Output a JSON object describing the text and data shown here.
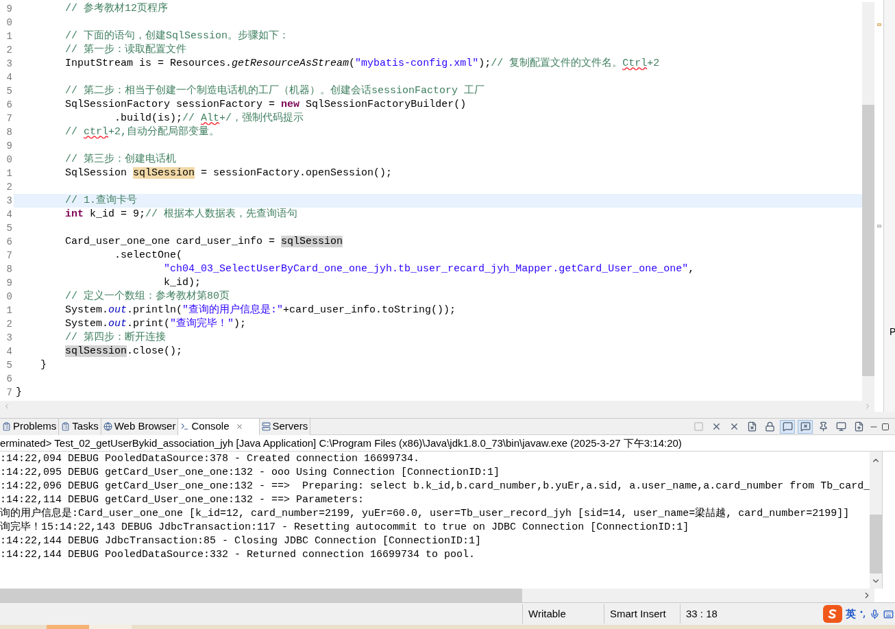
{
  "editor": {
    "lines": [
      {
        "number": "9",
        "current": false,
        "segments": [
          {
            "kind": "comment",
            "text": "        // 参考教材12页程序"
          }
        ]
      },
      {
        "number": "0",
        "current": false
      },
      {
        "number": "1",
        "current": false,
        "segments": [
          {
            "kind": "comment",
            "text": "        // 下面的语句，创建SqlSession。步骤如下："
          }
        ]
      },
      {
        "number": "2",
        "current": false,
        "segments": [
          {
            "kind": "comment",
            "text": "        // 第一步：读取配置文件"
          }
        ]
      },
      {
        "number": "3",
        "current": false,
        "segments": [
          {
            "kind": "plain",
            "text": "        InputStream is = Resources."
          },
          {
            "kind": "static",
            "text": "getResourceAsStream"
          },
          {
            "kind": "plain",
            "text": "("
          },
          {
            "kind": "string",
            "text": "\"mybatis-config.xml\""
          },
          {
            "kind": "plain",
            "text": ");"
          },
          {
            "kind": "comment",
            "text": "// 复制配置文件的文件名。"
          },
          {
            "kind": "typo",
            "text": "Ctrl"
          },
          {
            "kind": "comment",
            "text": "+2"
          }
        ]
      },
      {
        "number": "4",
        "current": false
      },
      {
        "number": "5",
        "current": false,
        "segments": [
          {
            "kind": "comment",
            "text": "        // 第二步：相当于创建一个制造电话机的工厂（机器）。创建会话sessionFactory 工厂"
          }
        ]
      },
      {
        "number": "6",
        "current": false,
        "segments": [
          {
            "kind": "plain",
            "text": "        SqlSessionFactory sessionFactory = "
          },
          {
            "kind": "keyword",
            "text": "new"
          },
          {
            "kind": "plain",
            "text": " SqlSessionFactoryBuilder()"
          }
        ]
      },
      {
        "number": "7",
        "current": false,
        "segments": [
          {
            "kind": "plain",
            "text": "                .build(is);"
          },
          {
            "kind": "comment",
            "text": "// "
          },
          {
            "kind": "typo",
            "text": "Alt"
          },
          {
            "kind": "comment",
            "text": "+/，强制代码提示"
          }
        ]
      },
      {
        "number": "8",
        "current": false,
        "segments": [
          {
            "kind": "comment",
            "text": "        // "
          },
          {
            "kind": "typo",
            "text": "ctrl"
          },
          {
            "kind": "comment",
            "text": "+2,自动分配局部变量。"
          }
        ]
      },
      {
        "number": "9",
        "current": false
      },
      {
        "number": "0",
        "current": false,
        "segments": [
          {
            "kind": "comment",
            "text": "        // 第三步：创建电话机"
          }
        ]
      },
      {
        "number": "1",
        "current": false,
        "segments": [
          {
            "kind": "plain",
            "text": "        SqlSession "
          },
          {
            "kind": "mark_write",
            "text": "sqlSession"
          },
          {
            "kind": "plain",
            "text": " = sessionFactory.openSession();"
          }
        ]
      },
      {
        "number": "2",
        "current": false
      },
      {
        "number": "3",
        "current": true,
        "segments": [
          {
            "kind": "comment",
            "text": "        // 1.查询卡号"
          }
        ]
      },
      {
        "number": "4",
        "current": false,
        "segments": [
          {
            "kind": "keyword",
            "text": "        int"
          },
          {
            "kind": "plain",
            "text": " k_id = 9;"
          },
          {
            "kind": "comment",
            "text": "// 根据本人数据表，先查询语句"
          }
        ]
      },
      {
        "number": "5",
        "current": false
      },
      {
        "number": "6",
        "current": false,
        "segments": [
          {
            "kind": "plain",
            "text": "        Card_user_one_one card_user_info = "
          },
          {
            "kind": "mark_read",
            "text": "sqlSession"
          }
        ]
      },
      {
        "number": "7",
        "current": false,
        "segments": [
          {
            "kind": "plain",
            "text": "                .selectOne("
          }
        ]
      },
      {
        "number": "8",
        "current": false,
        "segments": [
          {
            "kind": "string",
            "text": "                        \"ch04_03_SelectUserByCard_one_one_jyh.tb_user_recard_jyh_Mapper.getCard_User_one_one\""
          },
          {
            "kind": "plain",
            "text": ","
          }
        ]
      },
      {
        "number": "9",
        "current": false,
        "segments": [
          {
            "kind": "plain",
            "text": "                        k_id);"
          }
        ]
      },
      {
        "number": "0",
        "current": false,
        "segments": [
          {
            "kind": "comment",
            "text": "        // 定义一个数组：参考教材第80页"
          }
        ]
      },
      {
        "number": "1",
        "current": false,
        "segments": [
          {
            "kind": "plain",
            "text": "        System."
          },
          {
            "kind": "field",
            "text": "out"
          },
          {
            "kind": "plain",
            "text": ".println("
          },
          {
            "kind": "string",
            "text": "\"查询的用户信息是:\""
          },
          {
            "kind": "plain",
            "text": "+card_user_info.toString());"
          }
        ]
      },
      {
        "number": "2",
        "current": false,
        "segments": [
          {
            "kind": "plain",
            "text": "        System."
          },
          {
            "kind": "field",
            "text": "out"
          },
          {
            "kind": "plain",
            "text": ".print("
          },
          {
            "kind": "string",
            "text": "\"查询完毕！\""
          },
          {
            "kind": "plain",
            "text": ");"
          }
        ]
      },
      {
        "number": "3",
        "current": false,
        "segments": [
          {
            "kind": "comment",
            "text": "        // 第四步：断开连接"
          }
        ]
      },
      {
        "number": "4",
        "current": false,
        "segments": [
          {
            "kind": "mark_read",
            "text": "        sqlSession"
          },
          {
            "kind": "plain",
            "text": ".close();"
          }
        ]
      },
      {
        "number": "5",
        "current": false,
        "segments": [
          {
            "kind": "plain",
            "text": "    }"
          }
        ]
      },
      {
        "number": "6",
        "current": false
      },
      {
        "number": "7",
        "current": false,
        "segments": [
          {
            "kind": "plain",
            "text": "}"
          }
        ]
      }
    ]
  },
  "side_panel_fragment": "P",
  "console": {
    "tabs": [
      {
        "label": "Problems",
        "selected": false
      },
      {
        "label": "Tasks",
        "selected": false
      },
      {
        "label": "Web Browser",
        "selected": false
      },
      {
        "label": "Console",
        "selected": true
      },
      {
        "label": "Servers",
        "selected": false
      }
    ],
    "toolbar": [
      {
        "kind": "terminate",
        "disabled": true,
        "pressed": false
      },
      {
        "kind": "remove",
        "disabled": false,
        "pressed": false
      },
      {
        "kind": "remove_all",
        "disabled": false,
        "pressed": false
      },
      {
        "kind": "clear",
        "disabled": false,
        "pressed": false
      },
      {
        "kind": "scroll_lock",
        "disabled": false,
        "pressed": false
      },
      {
        "kind": "show_out",
        "disabled": false,
        "pressed": true
      },
      {
        "kind": "show_err",
        "disabled": false,
        "pressed": true
      },
      {
        "kind": "pin",
        "disabled": false,
        "pressed": false
      },
      {
        "kind": "display",
        "disabled": false,
        "pressed": false
      },
      {
        "kind": "new_console",
        "disabled": false,
        "pressed": false
      }
    ],
    "header": "erminated> Test_02_getUserBykid_association_jyh [Java Application] C:\\Program Files (x86)\\Java\\jdk1.8.0_73\\bin\\javaw.exe (2025-3-27 下午3:14:20)",
    "lines": [
      ":14:22,094 DEBUG PooledDataSource:378 - Created connection 16699734.",
      ":14:22,095 DEBUG getCard_User_one_one:132 - ooo Using Connection [ConnectionID:1]",
      ":14:22,096 DEBUG getCard_User_one_one:132 - ==>  Preparing: select b.k_id,b.card_number,b.yuEr,a.sid, a.user_name,a.card_number from Tb_card_",
      ":14:22,114 DEBUG getCard_User_one_one:132 - ==> Parameters: ",
      "询的用户信息是:Card_user_one_one [k_id=12, card_number=2199, yuEr=60.0, user=Tb_user_record_jyh [sid=14, user_name=梁喆越, card_number=2199]]",
      "询完毕！15:14:22,143 DEBUG JdbcTransaction:117 - Resetting autocommit to true on JDBC Connection [ConnectionID:1]",
      ":14:22,144 DEBUG JdbcTransaction:85 - Closing JDBC Connection [ConnectionID:1]",
      ":14:22,144 DEBUG PooledDataSource:332 - Returned connection 16699734 to pool."
    ]
  },
  "status_bar": [
    "Writable",
    "Smart Insert",
    "33 : 18"
  ],
  "ime": {
    "language": "英"
  }
}
